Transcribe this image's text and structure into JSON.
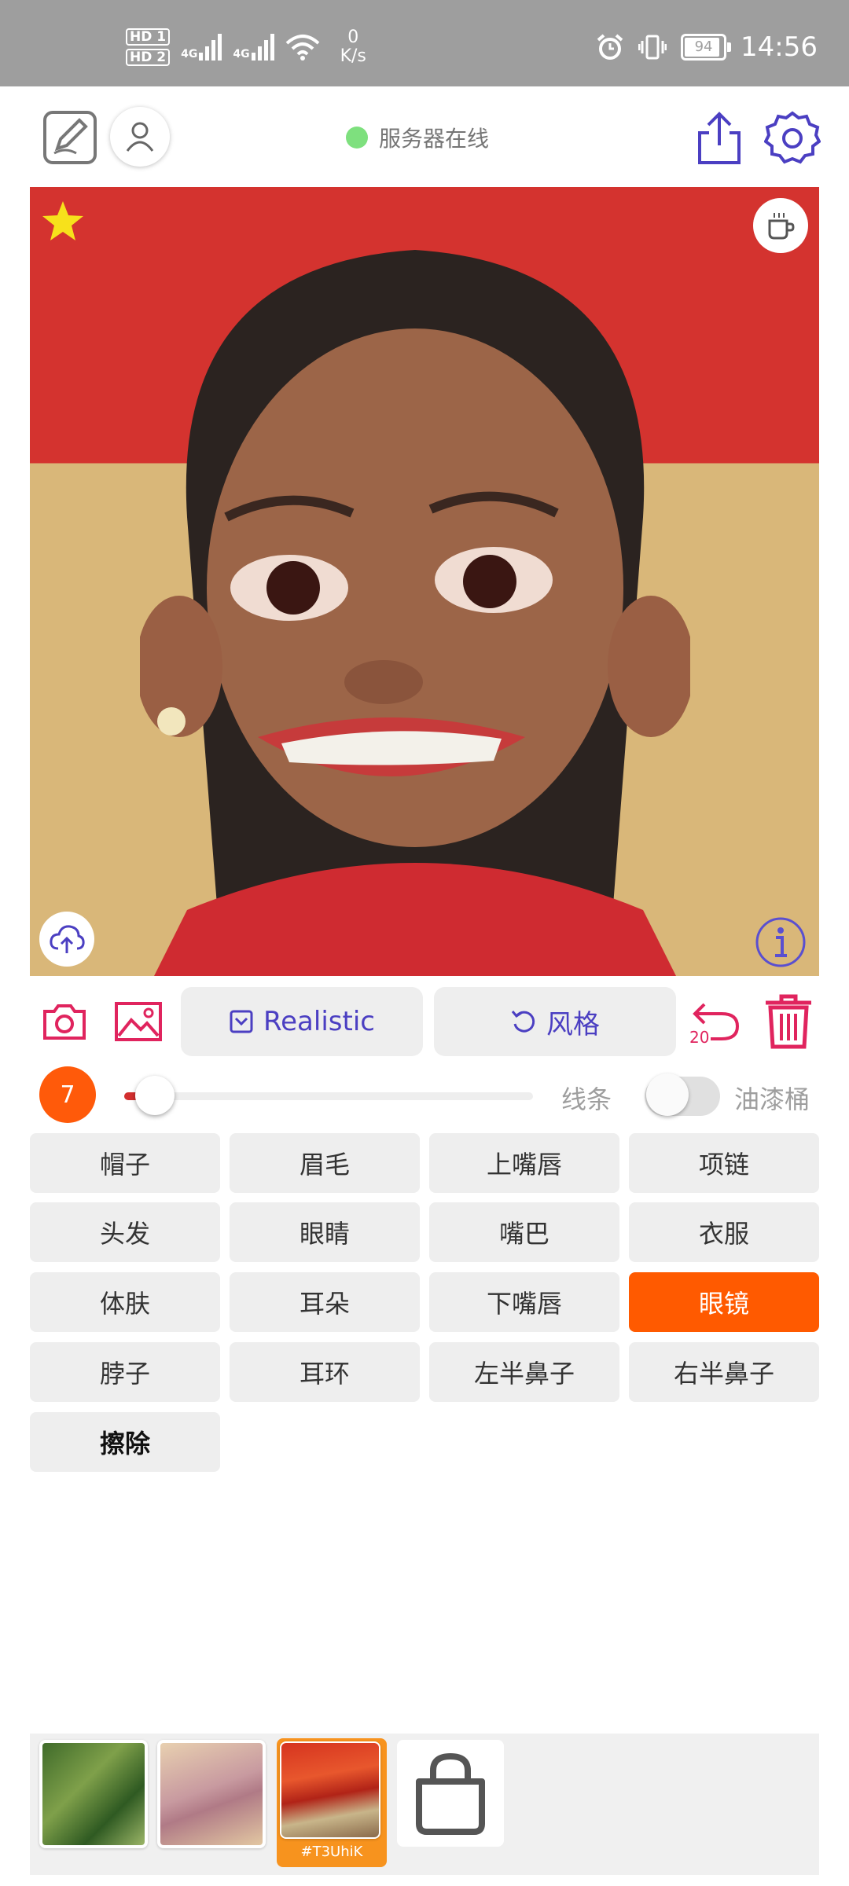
{
  "status_bar": {
    "hd1": "HD 1",
    "hd2": "HD 2",
    "net1": "4G",
    "net2": "4G",
    "speed_value": "0",
    "speed_unit": "K/s",
    "battery": "94",
    "time": "14:56"
  },
  "header": {
    "server_status": "服务器在线",
    "status_color": "#7ee07e"
  },
  "toolbar": {
    "mode_label": "Realistic",
    "style_label": "风格",
    "undo_count": "20"
  },
  "brush": {
    "size": "7",
    "level": 0.03,
    "lines_label": "线条",
    "bucket_label": "油漆桶"
  },
  "parts": [
    {
      "label": "帽子"
    },
    {
      "label": "眉毛"
    },
    {
      "label": "上嘴唇"
    },
    {
      "label": "项链"
    },
    {
      "label": "头发"
    },
    {
      "label": "眼睛"
    },
    {
      "label": "嘴巴"
    },
    {
      "label": "衣服"
    },
    {
      "label": "体肤"
    },
    {
      "label": "耳朵"
    },
    {
      "label": "下嘴唇"
    },
    {
      "label": "眼镜",
      "active": true
    },
    {
      "label": "脖子"
    },
    {
      "label": "耳环"
    },
    {
      "label": "左半鼻子"
    },
    {
      "label": "右半鼻子"
    },
    {
      "label": "擦除"
    }
  ],
  "gallery": {
    "selected_tag": "#T3UhiK"
  },
  "colors": {
    "accent_purple": "#4b3fc2",
    "accent_pink": "#e0245e",
    "active_orange": "#ff5a00",
    "badge_orange": "#ff5a0a"
  },
  "icons": [
    "edit-icon",
    "user-icon",
    "share-icon",
    "settings-icon",
    "star-icon",
    "coffee-icon",
    "upload-cloud-icon",
    "info-icon",
    "camera-icon",
    "image-icon",
    "undo-icon",
    "trash-icon",
    "shopping-bag-icon"
  ]
}
